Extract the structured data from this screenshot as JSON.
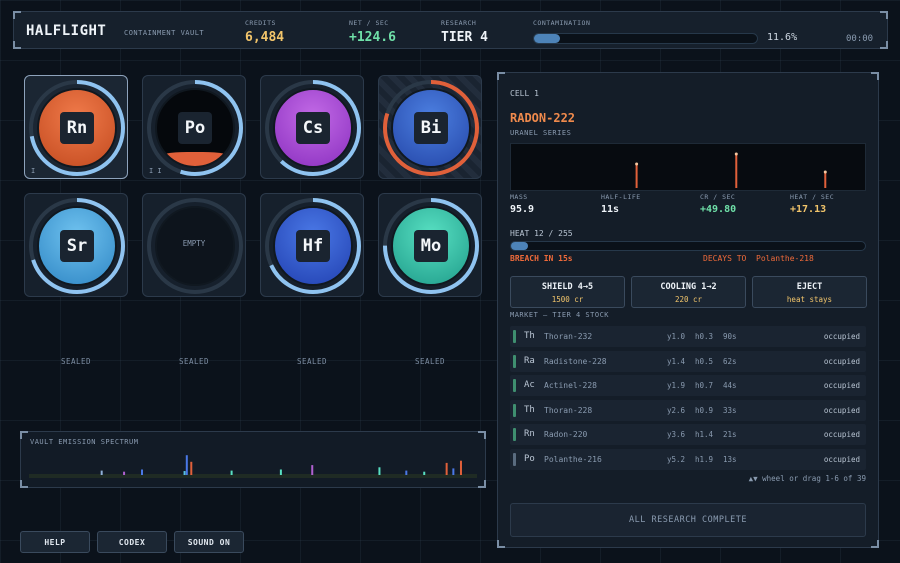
{
  "header": {
    "brand": "HALFLIGHT",
    "subtitle": "CONTAINMENT VAULT",
    "credits_label": "CREDITS",
    "credits": "6,484",
    "net_label": "NET / SEC",
    "net": "+124.6",
    "research_label": "RESEARCH",
    "research": "TIER 4",
    "contamination_label": "CONTAMINATION",
    "contamination_pct": "11.6%",
    "contamination_fraction": 0.116,
    "clock": "00:00"
  },
  "cells": [
    {
      "symbol": "Rn",
      "tally": "I",
      "color_top": "#f07a4a",
      "color_bottom": "#c24a1f",
      "ring": "#8fc3f0",
      "ring_fraction": 0.72,
      "selected": true
    },
    {
      "symbol": "Po",
      "tally": "I I",
      "color_top": "#05080c",
      "color_bottom": "#05080c",
      "fluid": "#e0603a",
      "ring": "#8fc3f0",
      "ring_fraction": 0.55
    },
    {
      "symbol": "Cs",
      "tally": "",
      "color_top": "#c26ae6",
      "color_bottom": "#8a2fbf",
      "ring": "#8fc3f0",
      "ring_fraction": 0.62
    },
    {
      "symbol": "Bi",
      "tally": "",
      "color_top": "#4c7fe0",
      "color_bottom": "#2446a8",
      "ring": "#e0603a",
      "ring_fraction": 0.8,
      "corrupt": true
    },
    {
      "symbol": "Sr",
      "tally": "",
      "color_top": "#6fc2ef",
      "color_bottom": "#2f86c4",
      "ring": "#8fc3f0",
      "ring_fraction": 0.7
    },
    {
      "symbol": "",
      "empty_label": "EMPTY",
      "ring": "#3a4a5d",
      "ring_fraction": 0
    },
    {
      "symbol": "Hf",
      "tally": "",
      "color_top": "#4a78e6",
      "color_bottom": "#2140b0",
      "ring": "#8fc3f0",
      "ring_fraction": 0.68
    },
    {
      "symbol": "Mo",
      "tally": "",
      "color_top": "#58e0c2",
      "color_bottom": "#1f9c8a",
      "ring": "#8fc3f0",
      "ring_fraction": 0.75
    }
  ],
  "sealed": [
    "SEALED",
    "SEALED",
    "SEALED",
    "SEALED"
  ],
  "spectrum": {
    "title": "VAULT EMISSION SPECTRUM",
    "lines": [
      {
        "pos": 0.16,
        "h": 0.2,
        "color": "#8fb0d8"
      },
      {
        "pos": 0.21,
        "h": 0.15,
        "color": "#b060d0"
      },
      {
        "pos": 0.25,
        "h": 0.25,
        "color": "#4a78e6"
      },
      {
        "pos": 0.345,
        "h": 0.18,
        "color": "#58c0e0"
      },
      {
        "pos": 0.35,
        "h": 0.9,
        "color": "#4a78e6"
      },
      {
        "pos": 0.36,
        "h": 0.6,
        "color": "#e0603a"
      },
      {
        "pos": 0.45,
        "h": 0.2,
        "color": "#58e0c2"
      },
      {
        "pos": 0.56,
        "h": 0.25,
        "color": "#58e0c2"
      },
      {
        "pos": 0.63,
        "h": 0.45,
        "color": "#b060d0"
      },
      {
        "pos": 0.78,
        "h": 0.35,
        "color": "#58e0c2"
      },
      {
        "pos": 0.84,
        "h": 0.2,
        "color": "#4a78e6"
      },
      {
        "pos": 0.88,
        "h": 0.15,
        "color": "#58e0c2"
      },
      {
        "pos": 0.93,
        "h": 0.55,
        "color": "#e0603a"
      },
      {
        "pos": 0.945,
        "h": 0.3,
        "color": "#4a78e6"
      },
      {
        "pos": 0.962,
        "h": 0.65,
        "color": "#e0603a"
      }
    ]
  },
  "buttons": {
    "help": "HELP",
    "codex": "CODEX",
    "sound": "SOUND ON"
  },
  "panel": {
    "cell_id": "CELL 1",
    "name": "RADON-222",
    "series": "URANEL SERIES",
    "emission": [
      {
        "pos": 0.35,
        "h": 0.6
      },
      {
        "pos": 0.63,
        "h": 0.85
      },
      {
        "pos": 0.88,
        "h": 0.4
      }
    ],
    "stats": [
      {
        "label": "MASS",
        "value": "95.9",
        "color": "#eef3f8"
      },
      {
        "label": "HALF-LIFE",
        "value": "11s",
        "color": "#eef3f8"
      },
      {
        "label": "CR / SEC",
        "value": "+49.80",
        "color": "#6fe0a8"
      },
      {
        "label": "HEAT / SEC",
        "value": "+17.13",
        "color": "#f2c56b"
      }
    ],
    "heat_label": "HEAT  12 / 255",
    "heat_fraction": 0.047,
    "breach": "BREACH IN 15s",
    "decays_label": "DECAYS TO",
    "decays_target": "Polanthe-218",
    "actions": [
      {
        "title": "SHIELD 4→5",
        "sub": "1500 cr"
      },
      {
        "title": "COOLING 1→2",
        "sub": "220 cr"
      },
      {
        "title": "EJECT",
        "sub": "heat stays"
      }
    ],
    "market_title": "MARKET  —  TIER 4 STOCK",
    "market": [
      {
        "sym": "Th",
        "name": "Thoran-232",
        "y": "y1.0",
        "h": "h0.3",
        "t": "90s",
        "status": "occupied",
        "color": "#3f8f70"
      },
      {
        "sym": "Ra",
        "name": "Radistone-228",
        "y": "y1.4",
        "h": "h0.5",
        "t": "62s",
        "status": "occupied",
        "color": "#3f8f70"
      },
      {
        "sym": "Ac",
        "name": "Actinel-228",
        "y": "y1.9",
        "h": "h0.7",
        "t": "44s",
        "status": "occupied",
        "color": "#3f8f70"
      },
      {
        "sym": "Th",
        "name": "Thoran-228",
        "y": "y2.6",
        "h": "h0.9",
        "t": "33s",
        "status": "occupied",
        "color": "#3f8f70"
      },
      {
        "sym": "Rn",
        "name": "Radon-220",
        "y": "y3.6",
        "h": "h1.4",
        "t": "21s",
        "status": "occupied",
        "color": "#3f8f70"
      },
      {
        "sym": "Po",
        "name": "Polanthe-216",
        "y": "y5.2",
        "h": "h1.9",
        "t": "13s",
        "status": "occupied",
        "color": "#5a6c80"
      }
    ],
    "scroll_hint": "▲▼ wheel or drag  1-6 of 39",
    "research_button": "ALL RESEARCH COMPLETE"
  }
}
